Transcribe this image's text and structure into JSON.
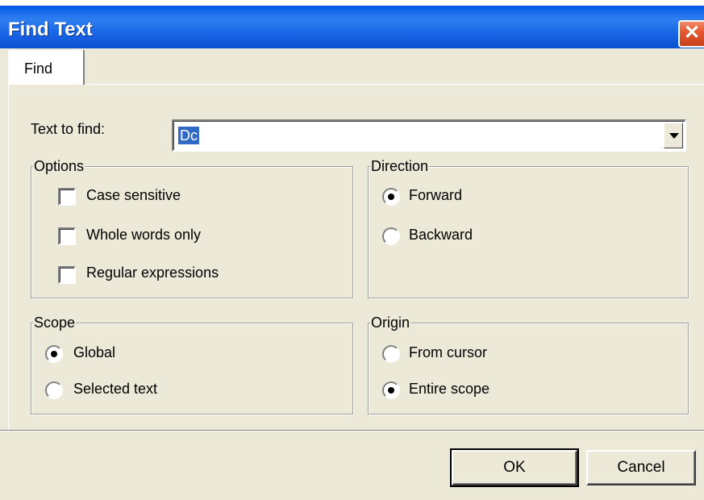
{
  "window": {
    "title": "Find Text",
    "close_label": "✕"
  },
  "tabs": [
    {
      "label": "Find"
    }
  ],
  "text_to_find": {
    "label": "Text to find:",
    "value": "Dc"
  },
  "options": {
    "title": "Options",
    "items": [
      {
        "label": "Case sensitive",
        "checked": false
      },
      {
        "label": "Whole words only",
        "checked": false
      },
      {
        "label": "Regular expressions",
        "checked": false
      }
    ]
  },
  "direction": {
    "title": "Direction",
    "items": [
      {
        "label": "Forward",
        "selected": true
      },
      {
        "label": "Backward",
        "selected": false
      }
    ]
  },
  "scope": {
    "title": "Scope",
    "items": [
      {
        "label": "Global",
        "selected": true
      },
      {
        "label": "Selected text",
        "selected": false
      }
    ]
  },
  "origin": {
    "title": "Origin",
    "items": [
      {
        "label": "From cursor",
        "selected": false
      },
      {
        "label": "Entire scope",
        "selected": true
      }
    ]
  },
  "buttons": {
    "ok": "OK",
    "cancel": "Cancel"
  },
  "colors": {
    "title_bar": "#0058e6",
    "dialog_bg": "#ece9d8",
    "selection": "#316ac5",
    "close_button": "#e55a33"
  }
}
